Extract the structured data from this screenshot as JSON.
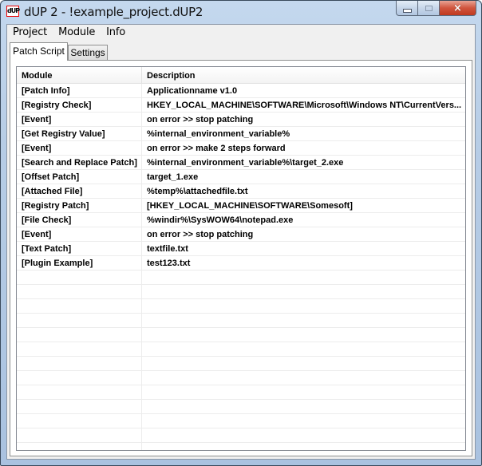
{
  "window": {
    "title": "dUP 2 - !example_project.dUP2",
    "icon_text": "dUP",
    "caption": {
      "minimize": "minimize-icon",
      "maximize": "maximize-icon",
      "close": "×"
    }
  },
  "menubar": {
    "items": [
      {
        "label": "Project"
      },
      {
        "label": "Module"
      },
      {
        "label": "Info"
      }
    ]
  },
  "tabs": [
    {
      "label": "Patch Script",
      "active": true
    },
    {
      "label": "Settings",
      "active": false
    }
  ],
  "table": {
    "headers": [
      "Module",
      "Description"
    ],
    "rows": [
      {
        "module": "[Patch Info]",
        "description": "Applicationname v1.0"
      },
      {
        "module": "[Registry Check]",
        "description": "HKEY_LOCAL_MACHINE\\SOFTWARE\\Microsoft\\Windows NT\\CurrentVers..."
      },
      {
        "module": "[Event]",
        "description": "on error  >>  stop patching"
      },
      {
        "module": "[Get Registry Value]",
        "description": "%internal_environment_variable%"
      },
      {
        "module": "[Event]",
        "description": "on error  >>  make 2 steps forward"
      },
      {
        "module": "[Search and Replace Patch]",
        "description": "%internal_environment_variable%\\target_2.exe"
      },
      {
        "module": "[Offset Patch]",
        "description": "target_1.exe"
      },
      {
        "module": "[Attached File]",
        "description": "%temp%\\attachedfile.txt"
      },
      {
        "module": "[Registry Patch]",
        "description": "[HKEY_LOCAL_MACHINE\\SOFTWARE\\Somesoft]"
      },
      {
        "module": "[File Check]",
        "description": "%windir%\\SysWOW64\\notepad.exe"
      },
      {
        "module": "[Event]",
        "description": "on error  >>  stop patching"
      },
      {
        "module": "[Text Patch]",
        "description": "textfile.txt"
      },
      {
        "module": "[Plugin Example]",
        "description": "test123.txt"
      }
    ],
    "empty_rows": 13
  }
}
